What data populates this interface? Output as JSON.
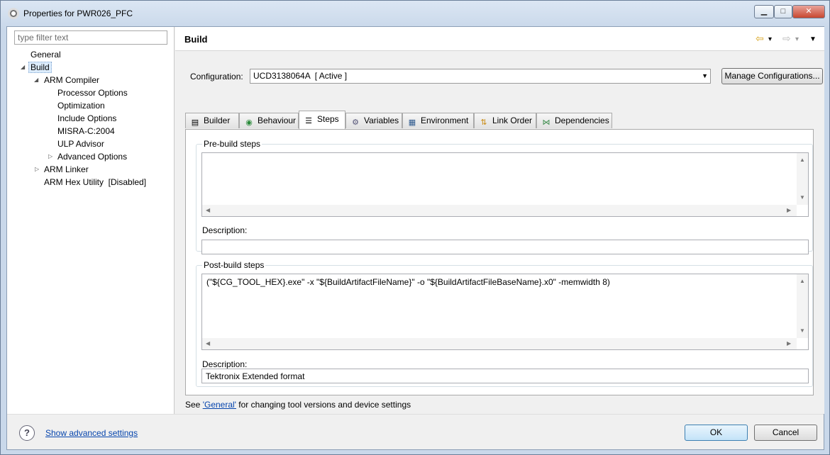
{
  "window": {
    "title": "Properties for PWR026_PFC",
    "minimize_glyph": "▁",
    "maximize_glyph": "□",
    "close_glyph": "✕"
  },
  "sidebar": {
    "filter_placeholder": "type filter text",
    "items": [
      {
        "label": "General"
      },
      {
        "label": "Build",
        "expander": "◢",
        "selected": true
      },
      {
        "label": "ARM Compiler",
        "expander": "◢"
      },
      {
        "label": "Processor Options"
      },
      {
        "label": "Optimization"
      },
      {
        "label": "Include Options"
      },
      {
        "label": "MISRA-C:2004"
      },
      {
        "label": "ULP Advisor"
      },
      {
        "label": "Advanced Options",
        "expander": "▷"
      },
      {
        "label": "ARM Linker",
        "expander": "▷"
      },
      {
        "label": "ARM Hex Utility  [Disabled]"
      }
    ]
  },
  "header": {
    "title": "Build",
    "back_icon": "⇦",
    "forward_icon": "⇨",
    "dropdown_glyph": "▾",
    "menu_glyph": "▼"
  },
  "configuration": {
    "label": "Configuration:",
    "selected": "UCD3138064A  [ Active ]",
    "dropdown_glyph": "▼",
    "manage_button": "Manage Configurations..."
  },
  "tabs": [
    {
      "label": "Builder",
      "icon": "▤",
      "active": false
    },
    {
      "label": "Behaviour",
      "icon": "◉",
      "active": false
    },
    {
      "label": "Steps",
      "icon": "☰",
      "active": true
    },
    {
      "label": "Variables",
      "icon": "⚙",
      "active": false
    },
    {
      "label": "Environment",
      "icon": "▦",
      "active": false
    },
    {
      "label": "Link Order",
      "icon": "⇅",
      "active": false
    },
    {
      "label": "Dependencies",
      "icon": "⋈",
      "active": false
    }
  ],
  "steps": {
    "pre_build": {
      "group_label": "Pre-build steps",
      "command": "",
      "description_label": "Description:",
      "description": ""
    },
    "post_build": {
      "group_label": "Post-build steps",
      "command": "(\"${CG_TOOL_HEX}.exe\" -x \"${BuildArtifactFileName}\" -o \"${BuildArtifactFileBaseName}.x0\" -memwidth 8)",
      "description_label": "Description:",
      "description": "Tektronix Extended format"
    },
    "scroll_up": "▲",
    "scroll_down": "▼",
    "scroll_left": "◀",
    "scroll_right": "▶"
  },
  "footer_note": {
    "prefix": "See ",
    "link": "'General'",
    "suffix": " for changing tool versions and device settings"
  },
  "bottom": {
    "help_glyph": "?",
    "advanced_link": "Show advanced settings",
    "ok": "OK",
    "cancel": "Cancel"
  }
}
